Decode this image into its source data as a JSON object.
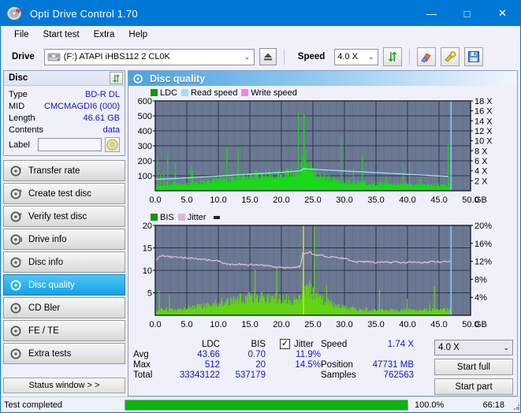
{
  "window": {
    "title": "Opti Drive Control 1.70",
    "icon": "disc-icon",
    "minimize": "—",
    "maximize": "□",
    "close": "✕"
  },
  "menu": [
    {
      "label": "File"
    },
    {
      "label": "Start test"
    },
    {
      "label": "Extra"
    },
    {
      "label": "Help"
    }
  ],
  "toolbar": {
    "drive_label": "Drive",
    "drive_value": "(F:)  ATAPI iHBS112  2 CL0K",
    "eject_icon": "eject-icon",
    "speed_label": "Speed",
    "speed_value": "4.0 X",
    "refresh_icon": "refresh-icon",
    "erase_icon": "eraser-icon",
    "tools_icon": "tools-icon",
    "save_icon": "save-icon",
    "chevron": "⌄"
  },
  "disc": {
    "title": "Disc",
    "refresh_icon": "refresh-icon",
    "rows": [
      {
        "key": "Type",
        "value": "BD-R DL"
      },
      {
        "key": "MID",
        "value": "CMCMAGDI6 (000)"
      },
      {
        "key": "Length",
        "value": "46.61 GB"
      },
      {
        "key": "Contents",
        "value": "data"
      }
    ],
    "label_key": "Label",
    "label_value": "",
    "label_placeholder": "",
    "label_button_icon": "disc-icon"
  },
  "nav": {
    "items": [
      {
        "label": "Transfer rate",
        "icon": "disc-test-icon",
        "active": false
      },
      {
        "label": "Create test disc",
        "icon": "disc-burn-icon",
        "active": false
      },
      {
        "label": "Verify test disc",
        "icon": "disc-verify-icon",
        "active": false
      },
      {
        "label": "Drive info",
        "icon": "drive-info-icon",
        "active": false
      },
      {
        "label": "Disc info",
        "icon": "disc-info-icon",
        "active": false
      },
      {
        "label": "Disc quality",
        "icon": "disc-quality-icon",
        "active": true
      },
      {
        "label": "CD Bler",
        "icon": "cd-bler-icon",
        "active": false
      },
      {
        "label": "FE / TE",
        "icon": "fe-te-icon",
        "active": false
      },
      {
        "label": "Extra tests",
        "icon": "extra-tests-icon",
        "active": false
      }
    ],
    "status_window": "Status window > >"
  },
  "content": {
    "header_title": "Disc quality",
    "header_icon": "disc-quality-icon"
  },
  "stats": {
    "col_ldc": "LDC",
    "col_bis": "BIS",
    "jitter_label": "Jitter",
    "jitter_checked": true,
    "check_glyph": "✓",
    "row_avg": "Avg",
    "row_max": "Max",
    "row_total": "Total",
    "avg_ldc": "43.66",
    "avg_bis": "0.70",
    "avg_jitter": "11.9%",
    "max_ldc": "512",
    "max_bis": "20",
    "max_jitter": "14.5%",
    "total_ldc": "33343122",
    "total_bis": "537179",
    "speed_label": "Speed",
    "speed_value": "1.74 X",
    "position_label": "Position",
    "position_value": "47731 MB",
    "samples_label": "Samples",
    "samples_value": "762563",
    "speed_select": "4.0 X",
    "chevron": "⌄",
    "start_full": "Start full",
    "start_part": "Start part"
  },
  "statusbar": {
    "text": "Test completed",
    "progress": 100,
    "percent": "100.0%",
    "time": "66:18",
    "fill_color": "#0ab40a"
  },
  "colors": {
    "accent": "#0078d7",
    "plot_bg": "#6b7894",
    "ldc_green": "#18d818",
    "bis_green": "#73d616",
    "read_speed": "#9fe0f7",
    "write_speed": "#ff7fe0",
    "jitter_pink": "#e0b5d8",
    "value_blue": "#1414c8"
  },
  "chart_data": [
    {
      "type": "area",
      "name": "ldc-chart",
      "title": "",
      "xlabel": "GB",
      "ylabel": "LDC",
      "xlim": [
        0,
        50
      ],
      "ylim": [
        0,
        600
      ],
      "xticks": [
        "0.0",
        "5.0",
        "10.0",
        "15.0",
        "20.0",
        "25.0",
        "30.0",
        "35.0",
        "40.0",
        "45.0",
        "50.0"
      ],
      "xtick_values": [
        0,
        5,
        10,
        15,
        20,
        25,
        30,
        35,
        40,
        45,
        50
      ],
      "yticks": [
        "100",
        "200",
        "300",
        "400",
        "500",
        "600"
      ],
      "ytick_values": [
        100,
        200,
        300,
        400,
        500,
        600
      ],
      "y2label": "X",
      "y2lim": [
        0,
        18
      ],
      "y2ticks": [
        "2 X",
        "4 X",
        "6 X",
        "8 X",
        "10 X",
        "12 X",
        "14 X",
        "16 X",
        "18 X"
      ],
      "y2tick_values": [
        2,
        4,
        6,
        8,
        10,
        12,
        14,
        16,
        18
      ],
      "grid": true,
      "legend": [
        {
          "label": "LDC",
          "color": "#0a9b0a"
        },
        {
          "label": "Read speed",
          "color": "#9fe0f7"
        },
        {
          "label": "Write speed",
          "color": "#ff7fe0"
        }
      ],
      "data_end_x": 46.9,
      "ldc_baseline": [
        {
          "x": 0,
          "y": 55
        },
        {
          "x": 1,
          "y": 58
        },
        {
          "x": 2,
          "y": 60
        },
        {
          "x": 3,
          "y": 62
        },
        {
          "x": 4,
          "y": 64
        },
        {
          "x": 5,
          "y": 66
        },
        {
          "x": 6,
          "y": 68
        },
        {
          "x": 7,
          "y": 72
        },
        {
          "x": 8,
          "y": 78
        },
        {
          "x": 9,
          "y": 86
        },
        {
          "x": 10,
          "y": 95
        },
        {
          "x": 11,
          "y": 104
        },
        {
          "x": 12,
          "y": 112
        },
        {
          "x": 13,
          "y": 120
        },
        {
          "x": 14,
          "y": 128
        },
        {
          "x": 15,
          "y": 134
        },
        {
          "x": 16,
          "y": 140
        },
        {
          "x": 17,
          "y": 144
        },
        {
          "x": 18,
          "y": 148
        },
        {
          "x": 19,
          "y": 150
        },
        {
          "x": 20,
          "y": 152
        },
        {
          "x": 21,
          "y": 156
        },
        {
          "x": 22,
          "y": 165
        },
        {
          "x": 23,
          "y": 190
        },
        {
          "x": 23.5,
          "y": 320
        },
        {
          "x": 24,
          "y": 260
        },
        {
          "x": 24.5,
          "y": 215
        },
        {
          "x": 25,
          "y": 185
        },
        {
          "x": 26,
          "y": 150
        },
        {
          "x": 27,
          "y": 120
        },
        {
          "x": 28,
          "y": 100
        },
        {
          "x": 29,
          "y": 88
        },
        {
          "x": 30,
          "y": 80
        },
        {
          "x": 32,
          "y": 72
        },
        {
          "x": 34,
          "y": 66
        },
        {
          "x": 36,
          "y": 62
        },
        {
          "x": 38,
          "y": 58
        },
        {
          "x": 40,
          "y": 56
        },
        {
          "x": 42,
          "y": 54
        },
        {
          "x": 44,
          "y": 52
        },
        {
          "x": 46,
          "y": 52
        },
        {
          "x": 46.9,
          "y": 52
        }
      ],
      "ldc_max_peak": {
        "x": 23.6,
        "y": 512
      },
      "read_speed_curve": [
        {
          "x": 0,
          "y": 2.3
        },
        {
          "x": 4,
          "y": 2.5
        },
        {
          "x": 8,
          "y": 2.8
        },
        {
          "x": 12,
          "y": 3.1
        },
        {
          "x": 16,
          "y": 3.4
        },
        {
          "x": 20,
          "y": 3.7
        },
        {
          "x": 23,
          "y": 4.0
        },
        {
          "x": 23.5,
          "y": 4.4
        },
        {
          "x": 25,
          "y": 4.3
        },
        {
          "x": 28,
          "y": 4.1
        },
        {
          "x": 31,
          "y": 3.9
        },
        {
          "x": 34,
          "y": 3.7
        },
        {
          "x": 37,
          "y": 3.5
        },
        {
          "x": 40,
          "y": 3.3
        },
        {
          "x": 43,
          "y": 3.1
        },
        {
          "x": 46,
          "y": 2.9
        },
        {
          "x": 46.9,
          "y": 2.9
        }
      ],
      "cursor_x": 46.9
    },
    {
      "type": "area",
      "name": "bis-jitter-chart",
      "title": "",
      "xlabel": "GB",
      "ylabel": "BIS",
      "xlim": [
        0,
        50
      ],
      "ylim": [
        0,
        20
      ],
      "xticks": [
        "0.0",
        "5.0",
        "10.0",
        "15.0",
        "20.0",
        "25.0",
        "30.0",
        "35.0",
        "40.0",
        "45.0",
        "50.0"
      ],
      "xtick_values": [
        0,
        5,
        10,
        15,
        20,
        25,
        30,
        35,
        40,
        45,
        50
      ],
      "yticks": [
        "5",
        "10",
        "15",
        "20"
      ],
      "ytick_values": [
        5,
        10,
        15,
        20
      ],
      "y2label": "%",
      "y2lim": [
        0,
        20
      ],
      "y2ticks": [
        "4%",
        "8%",
        "12%",
        "16%",
        "20%"
      ],
      "y2tick_values": [
        4,
        8,
        12,
        16,
        20
      ],
      "grid": true,
      "legend": [
        {
          "label": "BIS",
          "color": "#0a9b0a"
        },
        {
          "label": "Jitter",
          "color": "#e0b5d8"
        }
      ],
      "data_end_x": 46.9,
      "bis_baseline": [
        {
          "x": 0,
          "y": 1.6
        },
        {
          "x": 2,
          "y": 1.7
        },
        {
          "x": 4,
          "y": 1.9
        },
        {
          "x": 6,
          "y": 2.3
        },
        {
          "x": 8,
          "y": 3.0
        },
        {
          "x": 10,
          "y": 3.8
        },
        {
          "x": 12,
          "y": 4.5
        },
        {
          "x": 14,
          "y": 5.1
        },
        {
          "x": 16,
          "y": 5.5
        },
        {
          "x": 18,
          "y": 5.4
        },
        {
          "x": 20,
          "y": 5.0
        },
        {
          "x": 22,
          "y": 4.6
        },
        {
          "x": 23,
          "y": 5.0
        },
        {
          "x": 23.5,
          "y": 9.5
        },
        {
          "x": 24,
          "y": 7.5
        },
        {
          "x": 24.6,
          "y": 8.0
        },
        {
          "x": 25,
          "y": 6.5
        },
        {
          "x": 26,
          "y": 5.2
        },
        {
          "x": 27,
          "y": 4.3
        },
        {
          "x": 28,
          "y": 3.4
        },
        {
          "x": 30,
          "y": 2.4
        },
        {
          "x": 32,
          "y": 1.9
        },
        {
          "x": 34,
          "y": 1.7
        },
        {
          "x": 36,
          "y": 1.6
        },
        {
          "x": 40,
          "y": 1.6
        },
        {
          "x": 44,
          "y": 1.6
        },
        {
          "x": 46.9,
          "y": 1.7
        }
      ],
      "bis_max_peak": {
        "x": 23.5,
        "y": 20
      },
      "jitter_curve": [
        {
          "x": 0,
          "y": 12.3
        },
        {
          "x": 1,
          "y": 13.3
        },
        {
          "x": 2,
          "y": 13.0
        },
        {
          "x": 3,
          "y": 12.9
        },
        {
          "x": 4,
          "y": 12.8
        },
        {
          "x": 5,
          "y": 12.8
        },
        {
          "x": 6,
          "y": 12.7
        },
        {
          "x": 7,
          "y": 12.6
        },
        {
          "x": 8,
          "y": 12.4
        },
        {
          "x": 9,
          "y": 12.2
        },
        {
          "x": 10,
          "y": 12.0
        },
        {
          "x": 11,
          "y": 11.6
        },
        {
          "x": 12,
          "y": 11.3
        },
        {
          "x": 13,
          "y": 11.4
        },
        {
          "x": 14,
          "y": 11.3
        },
        {
          "x": 15,
          "y": 11.2
        },
        {
          "x": 16,
          "y": 11.3
        },
        {
          "x": 17,
          "y": 11.1
        },
        {
          "x": 18,
          "y": 10.9
        },
        {
          "x": 19,
          "y": 10.8
        },
        {
          "x": 20,
          "y": 10.6
        },
        {
          "x": 21,
          "y": 10.6
        },
        {
          "x": 22,
          "y": 10.7
        },
        {
          "x": 23,
          "y": 10.9
        },
        {
          "x": 23.4,
          "y": 13.8
        },
        {
          "x": 24,
          "y": 13.9
        },
        {
          "x": 24.6,
          "y": 14.1
        },
        {
          "x": 25,
          "y": 13.6
        },
        {
          "x": 26,
          "y": 13.3
        },
        {
          "x": 27,
          "y": 13.1
        },
        {
          "x": 28,
          "y": 12.9
        },
        {
          "x": 29,
          "y": 12.8
        },
        {
          "x": 30,
          "y": 12.6
        },
        {
          "x": 31,
          "y": 12.2
        },
        {
          "x": 32,
          "y": 11.9
        },
        {
          "x": 33,
          "y": 11.9
        },
        {
          "x": 34,
          "y": 11.9
        },
        {
          "x": 35,
          "y": 11.8
        },
        {
          "x": 36,
          "y": 11.8
        },
        {
          "x": 37,
          "y": 11.8
        },
        {
          "x": 38,
          "y": 11.8
        },
        {
          "x": 39,
          "y": 11.8
        },
        {
          "x": 40,
          "y": 11.8
        },
        {
          "x": 41,
          "y": 11.8
        },
        {
          "x": 42,
          "y": 11.8
        },
        {
          "x": 43,
          "y": 11.8
        },
        {
          "x": 44,
          "y": 11.9
        },
        {
          "x": 45,
          "y": 11.9
        },
        {
          "x": 46,
          "y": 12.0
        },
        {
          "x": 46.9,
          "y": 12.1
        }
      ],
      "cursor_x": 46.9
    }
  ]
}
